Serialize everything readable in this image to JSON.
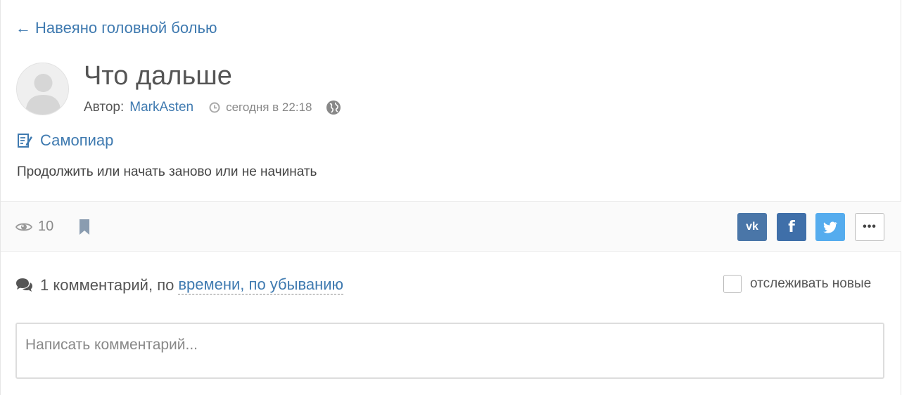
{
  "nav": {
    "back_label": "Навеяно головной болью"
  },
  "post": {
    "title": "Что дальше",
    "author_label": "Автор:",
    "author": "MarkAsten",
    "time": "сегодня в 22:18",
    "category": "Самопиар",
    "body": "Продолжить или начать заново или не начинать"
  },
  "stats": {
    "views": "10"
  },
  "share": {
    "vk": "vk",
    "fb": "f",
    "more": "•••"
  },
  "comments": {
    "summary": "1 комментарий, по",
    "sort_label": "времени, по убыванию",
    "follow_label": "отслеживать новые",
    "placeholder": "Написать комментарий..."
  },
  "colors": {
    "link": "#3f7ab0",
    "vk": "#4a76a8",
    "facebook": "#3f6fa9",
    "twitter": "#55acee"
  }
}
